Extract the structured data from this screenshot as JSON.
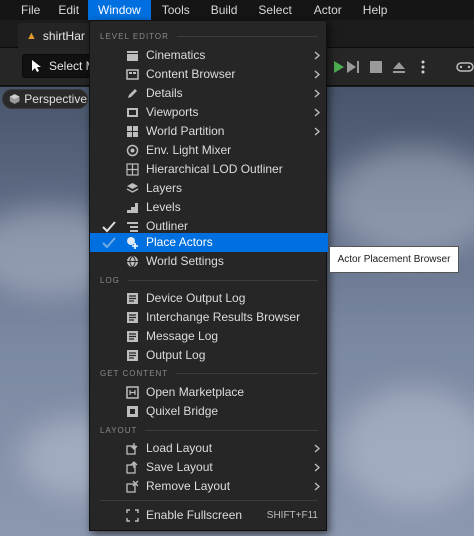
{
  "menubar": {
    "items": [
      "File",
      "Edit",
      "Window",
      "Tools",
      "Build",
      "Select",
      "Actor",
      "Help"
    ],
    "active": "Window"
  },
  "tab": {
    "label": "shirtHar",
    "icon": "level-icon"
  },
  "toolbar": {
    "select_mode_label": "Select M",
    "buttons": [
      "play-icon",
      "skip-icon",
      "stop-icon",
      "eject-icon",
      "more-options-icon",
      "gamepad-icon"
    ],
    "accent_play": "#4caf50"
  },
  "viewport": {
    "mode_label": "Perspective"
  },
  "window_menu": {
    "sections": [
      {
        "label": "LEVEL EDITOR",
        "items": [
          {
            "label": "Cinematics",
            "icon": "clapperboard-icon",
            "submenu": true
          },
          {
            "label": "Content Browser",
            "icon": "content-browser-icon",
            "submenu": true
          },
          {
            "label": "Details",
            "icon": "pencil-icon",
            "submenu": true
          },
          {
            "label": "Viewports",
            "icon": "viewport-icon",
            "submenu": true
          },
          {
            "label": "World Partition",
            "icon": "grid-icon",
            "submenu": true
          },
          {
            "label": "Env. Light Mixer",
            "icon": "light-mixer-icon"
          },
          {
            "label": "Hierarchical LOD Outliner",
            "icon": "lod-grid-icon"
          },
          {
            "label": "Layers",
            "icon": "layers-icon"
          },
          {
            "label": "Levels",
            "icon": "levels-icon"
          },
          {
            "label": "Outliner",
            "icon": "outliner-icon",
            "checked": true
          },
          {
            "label": "Place Actors",
            "icon": "place-actors-icon",
            "checked": true,
            "hover": true
          },
          {
            "label": "World Settings",
            "icon": "globe-icon"
          }
        ]
      },
      {
        "label": "LOG",
        "items": [
          {
            "label": "Device Output Log",
            "icon": "log-icon"
          },
          {
            "label": "Interchange Results Browser",
            "icon": "log-icon"
          },
          {
            "label": "Message Log",
            "icon": "log-icon"
          },
          {
            "label": "Output Log",
            "icon": "log-icon"
          }
        ]
      },
      {
        "label": "GET CONTENT",
        "items": [
          {
            "label": "Open Marketplace",
            "icon": "marketplace-icon"
          },
          {
            "label": "Quixel Bridge",
            "icon": "bridge-icon"
          }
        ]
      },
      {
        "label": "LAYOUT",
        "items": [
          {
            "label": "Load Layout",
            "icon": "load-layout-icon",
            "submenu": true
          },
          {
            "label": "Save Layout",
            "icon": "save-layout-icon",
            "submenu": true
          },
          {
            "label": "Remove Layout",
            "icon": "remove-layout-icon",
            "submenu": true
          }
        ]
      }
    ],
    "fullscreen": {
      "label": "Enable Fullscreen",
      "shortcut": "SHIFT+F11",
      "icon": "fullscreen-icon"
    }
  },
  "tooltip": {
    "text": "Actor Placement Browser"
  },
  "colors": {
    "accent": "#0070e0",
    "menu_bg": "#262626",
    "tooltip_bg": "#ffffff"
  }
}
